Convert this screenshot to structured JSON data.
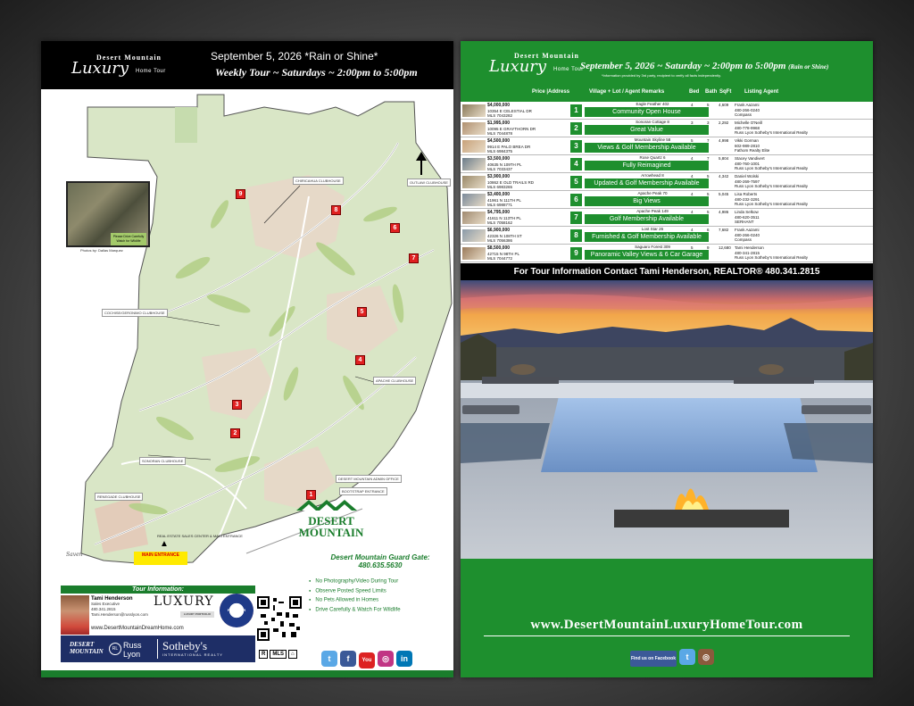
{
  "left": {
    "brand": {
      "line1": "Desert Mountain",
      "line2": "Luxury",
      "line3": "Home Tour"
    },
    "date_line": "September 5, 2026 *Rain or Shine*",
    "weekly_line": "Weekly Tour ~ Saturdays ~ 2:00pm to 5:00pm",
    "photo_caption": "Please Drive Carefully Watch for Wildlife",
    "photo_credit": "Photos by: Dallas Marquez",
    "clubhouses": [
      "CHIRICAHUA CLUBHOUSE",
      "OUTLAW CLUBHOUSE",
      "COCHISE/GERONIMO CLUBHOUSE",
      "APACHE CLUBHOUSE",
      "SONORAN CLUBHOUSE",
      "RENEGADE CLUBHOUSE",
      "DESERT MOUNTAIN ADMIN OFFICE",
      "BOOTSTRAP ENTRANCE"
    ],
    "re_center": "REAL ESTATE SALES CENTER & MAIN ENTRANCE",
    "main_entrance": "MAIN ENTRANCE",
    "saven": "Saven",
    "dm_logo": {
      "l1": "DESERT",
      "l2": "MOUNTAIN"
    },
    "guard": {
      "label": "Desert Mountain Guard Gate:",
      "phone": "480.635.5630"
    },
    "rules": [
      "No Photography/Video During Tour",
      "Observe Posted Speed Limits",
      "No Pets Allowed in Homes",
      "Drive Carefully & Watch For Wildlife"
    ],
    "tour_info": "Tour Information:",
    "agent": {
      "name": "Tami Henderson",
      "title": "Sales Executive",
      "phone": "480.341.2815",
      "email": "Tami.Henderson@russlyon.com"
    },
    "website": "www.DesertMountainDreamHome.com",
    "luxury_logo": "LUXURY",
    "luxury_sub": "LUXURY PORTFOLIO",
    "seal": "FIVE STAR",
    "bottom": {
      "dm1": "DESERT",
      "dm2": "MOUNTAIN",
      "rl1": "Russ",
      "rl2": "Lyon",
      "rl_icon": "RL",
      "sb1": "Sotheby's",
      "sb2": "INTERNATIONAL REALTY"
    },
    "eh": [
      "R",
      "MLS",
      "=",
      "⌂"
    ]
  },
  "right": {
    "brand": {
      "line1": "Desert Mountain",
      "line2": "Luxury",
      "line3": "Home Tour"
    },
    "date": "September 5, 2026 ~ Saturday ~ 2:00pm to 5:00pm",
    "rain": "(Rain or Shine)",
    "note": "*Information provided by 3rd party, recipient to verify all facts independently.",
    "columns": {
      "price": "Price |Address",
      "village": "Village + Lot / Agent Remarks",
      "bed": "Bed",
      "bath": "Bath",
      "sqft": "SqFt",
      "agent": "Listing  Agent"
    },
    "listings": [
      {
        "price": "$4,000,000",
        "addr": "10354 E CELESTIAL DR",
        "mls": "MLS 7043282",
        "num": "1",
        "village": "Eagle Feather 402",
        "remark": "Community Open House",
        "bed": "4",
        "bath": "5",
        "sqft": "4,609",
        "agent": "Frank Aazami",
        "agent_phone": "480-266-0240",
        "brokerage": "Compass"
      },
      {
        "price": "$1,995,000",
        "addr": "10095 E GRAYTHORN DR",
        "mls": "MLS 7044878",
        "num": "2",
        "village": "Sonoran Cottage 8",
        "remark": "Great Value",
        "bed": "3",
        "bath": "3",
        "sqft": "2,292",
        "agent": "Michelle O'Neill",
        "agent_phone": "480-778-9968",
        "brokerage": "Russ Lyon Sotheby's International Realty"
      },
      {
        "price": "$4,500,000",
        "addr": "9914 E PALO BREA DR",
        "mls": "MLS 6984375",
        "num": "3",
        "village": "Mountain Skyline 58",
        "remark": "Views & Golf Membership Available",
        "bed": "5",
        "bath": "7",
        "sqft": "4,998",
        "agent": "Vikki Gorman",
        "agent_phone": "602-989-2810",
        "brokerage": "Fathom Realty Elite"
      },
      {
        "price": "$3,500,000",
        "addr": "40635 N 109TH PL",
        "mls": "MLS 7033437",
        "num": "4",
        "village": "Rose Quartz 6",
        "remark": "Fully Reimagined",
        "bed": "4",
        "bath": "7",
        "sqft": "5,804",
        "agent": "Stacey Vandivert",
        "agent_phone": "480-760-1001",
        "brokerage": "Russ Lyon Sotheby's International Realty"
      },
      {
        "price": "$3,900,000",
        "addr": "10862 E OLD TRAILS RD",
        "mls": "MLS 6983265",
        "num": "5",
        "village": "Arrowhead 8",
        "remark": "Updated & Golf Membership Available",
        "bed": "4",
        "bath": "5",
        "sqft": "4,342",
        "agent": "Daniel Wolski",
        "agent_phone": "480-269-7597",
        "brokerage": "Russ Lyon Sotheby's International Realty"
      },
      {
        "price": "$3,400,000",
        "addr": "41961 N 111TH PL",
        "mls": "MLS 6988771",
        "num": "6",
        "village": "Apache Peak 70",
        "remark": "Big Views",
        "bed": "4",
        "bath": "5",
        "sqft": "5,045",
        "agent": "Lisa Roberts",
        "agent_phone": "480-232-3291",
        "brokerage": "Russ Lyon Sotheby's International Realty"
      },
      {
        "price": "$4,795,000",
        "addr": "41611 N 113TH PL",
        "mls": "MLS 7058162",
        "num": "7",
        "village": "Apache Peak 149",
        "remark": "Golf Membership Available",
        "bed": "4",
        "bath": "5",
        "sqft": "4,986",
        "agent": "Linda Selkow",
        "agent_phone": "480-620-3511",
        "brokerage": "SERHANT"
      },
      {
        "price": "$6,900,000",
        "addr": "42326 N 108TH ST",
        "mls": "MLS 7056386",
        "num": "8",
        "village": "Lost Star 26",
        "remark": "Furnished & Golf Membership Available",
        "bed": "4",
        "bath": "6",
        "sqft": "7,682",
        "agent": "Frank Aazami",
        "agent_phone": "480-266-0240",
        "brokerage": "Compass"
      },
      {
        "price": "$8,500,000",
        "addr": "42715 N 98TH PL",
        "mls": "MLS 7044772",
        "num": "9",
        "village": "Saguaro Forest 309",
        "remark": "Panoramic Valley Views & 6 Car Garage",
        "bed": "5",
        "bath": "9",
        "sqft": "12,680",
        "agent": "Tami Henderson",
        "agent_phone": "480-341-2815",
        "brokerage": "Russ Lyon Sotheby's International Realty"
      }
    ],
    "contact": "For Tour Information Contact Tami Henderson, REALTOR®  480.341.2815",
    "website": "www.DesertMountainLuxuryHomeTour.com",
    "social": {
      "fb": "Find us on Facebook",
      "tw": "t",
      "ig": "◎"
    }
  },
  "social_left": [
    "t",
    "f",
    "You",
    "◎",
    "in"
  ],
  "colors": {
    "green": "#1e8f2e",
    "dark_green": "#1a7d2c",
    "marker_red": "#e02020",
    "navy": "#1e2e66"
  }
}
